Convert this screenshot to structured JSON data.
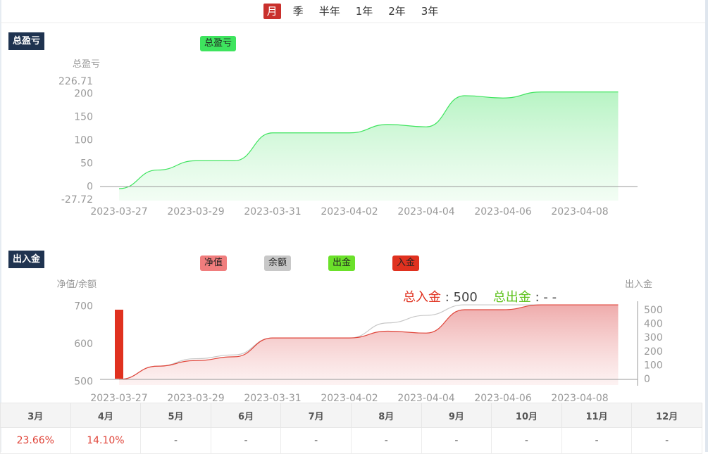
{
  "periods": {
    "items": [
      "月",
      "季",
      "半年",
      "1年",
      "2年",
      "3年"
    ],
    "active_index": 0
  },
  "pnl_section": {
    "tag": "总盈亏",
    "legend": "总盈亏",
    "legend_color": "#3ee45e"
  },
  "flow_section": {
    "tag": "出入金",
    "legend": [
      {
        "label": "净值",
        "color": "#f07d7d"
      },
      {
        "label": "余额",
        "color": "#c8c8c8"
      },
      {
        "label": "出金",
        "color": "#6be12a"
      },
      {
        "label": "入金",
        "color": "#e0311f"
      }
    ],
    "stats": {
      "in_label": "总入金",
      "in_value": "500",
      "out_label": "总出金",
      "out_value": "- -"
    }
  },
  "chart_data": [
    {
      "type": "area",
      "ylabel": "总盈亏",
      "ylim": [
        -27.72,
        226.71
      ],
      "y_ticks": [
        "226.71",
        "200",
        "150",
        "100",
        "50",
        "0",
        "-27.72"
      ],
      "x_ticks": [
        "2023-03-27",
        "2023-03-29",
        "2023-03-31",
        "2023-04-02",
        "2023-04-04",
        "2023-04-06",
        "2023-04-08"
      ],
      "series": [
        {
          "name": "总盈亏",
          "color": "#3ee45e",
          "x": [
            "2023-03-27",
            "2023-03-28",
            "2023-03-29",
            "2023-03-30",
            "2023-03-31",
            "2023-04-01",
            "2023-04-02",
            "2023-04-03",
            "2023-04-04",
            "2023-04-05",
            "2023-04-06",
            "2023-04-07",
            "2023-04-08",
            "2023-04-09"
          ],
          "values": [
            -5,
            35,
            55,
            55,
            115,
            115,
            115,
            133,
            128,
            195,
            190,
            203,
            203,
            203
          ]
        }
      ]
    },
    {
      "type": "line",
      "ylabel_left": "净值/余额",
      "ylabel_right": "出入金",
      "ylim_left": [
        490,
        705
      ],
      "ylim_right": [
        0,
        510
      ],
      "y_ticks_left": [
        "700",
        "600",
        "500"
      ],
      "y_ticks_right": [
        "500",
        "400",
        "300",
        "200",
        "100",
        "0"
      ],
      "x_ticks": [
        "2023-03-27",
        "2023-03-29",
        "2023-03-31",
        "2023-04-02",
        "2023-04-04",
        "2023-04-06",
        "2023-04-08"
      ],
      "x": [
        "2023-03-27",
        "2023-03-28",
        "2023-03-29",
        "2023-03-30",
        "2023-03-31",
        "2023-04-01",
        "2023-04-02",
        "2023-04-03",
        "2023-04-04",
        "2023-04-05",
        "2023-04-06",
        "2023-04-07",
        "2023-04-08",
        "2023-04-09"
      ],
      "series": [
        {
          "name": "净值",
          "color": "#e0453a",
          "values": [
            505,
            540,
            555,
            565,
            615,
            615,
            615,
            633,
            628,
            690,
            690,
            703,
            703,
            703
          ]
        },
        {
          "name": "余额",
          "color": "#c8c8c8",
          "values": [
            505,
            540,
            560,
            570,
            615,
            615,
            615,
            655,
            675,
            703,
            703,
            703,
            703,
            703
          ]
        },
        {
          "name": "入金",
          "color": "#e0311f",
          "type": "bar",
          "values": [
            500,
            0,
            0,
            0,
            0,
            0,
            0,
            0,
            0,
            0,
            0,
            0,
            0,
            0
          ]
        }
      ]
    }
  ],
  "months_table": {
    "headers": [
      "3月",
      "4月",
      "5月",
      "6月",
      "7月",
      "8月",
      "9月",
      "10月",
      "11月",
      "12月"
    ],
    "values": [
      "23.66%",
      "14.10%",
      "-",
      "-",
      "-",
      "-",
      "-",
      "-",
      "-",
      "-"
    ]
  }
}
